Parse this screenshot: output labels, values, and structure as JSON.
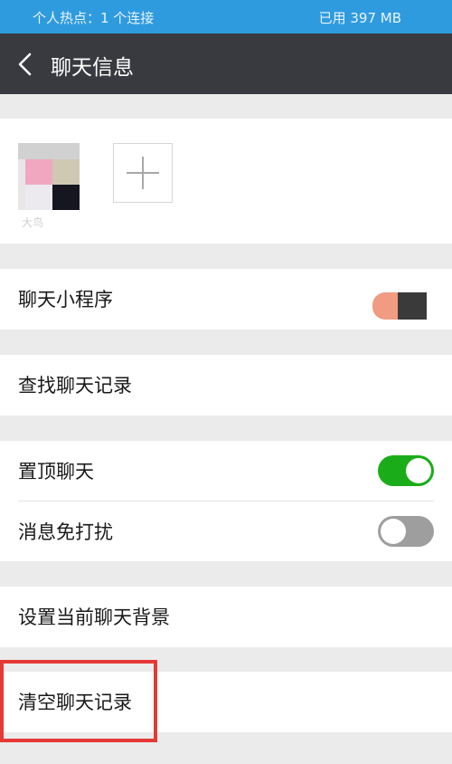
{
  "status_bar": {
    "left_text": "个人热点：1 个连接",
    "right_text": "已用 397 MB"
  },
  "header": {
    "title": "聊天信息",
    "back_icon": "chevron-left-icon"
  },
  "members": {
    "member_name": "大鸟",
    "add_icon": "plus-icon"
  },
  "rows": {
    "mini_program": "聊天小程序",
    "search_history": "查找聊天记录",
    "pin_chat": "置顶聊天",
    "mute": "消息免打扰",
    "set_background": "设置当前聊天背景",
    "clear_history": "清空聊天记录"
  },
  "toggles": {
    "pin_chat_on": true,
    "mute_on": false
  },
  "colors": {
    "status_bar": "#2f9bdf",
    "title_bar": "#393a3f",
    "toggle_on": "#1aad19",
    "toggle_off": "#9e9e9e",
    "highlight": "#e53935"
  }
}
